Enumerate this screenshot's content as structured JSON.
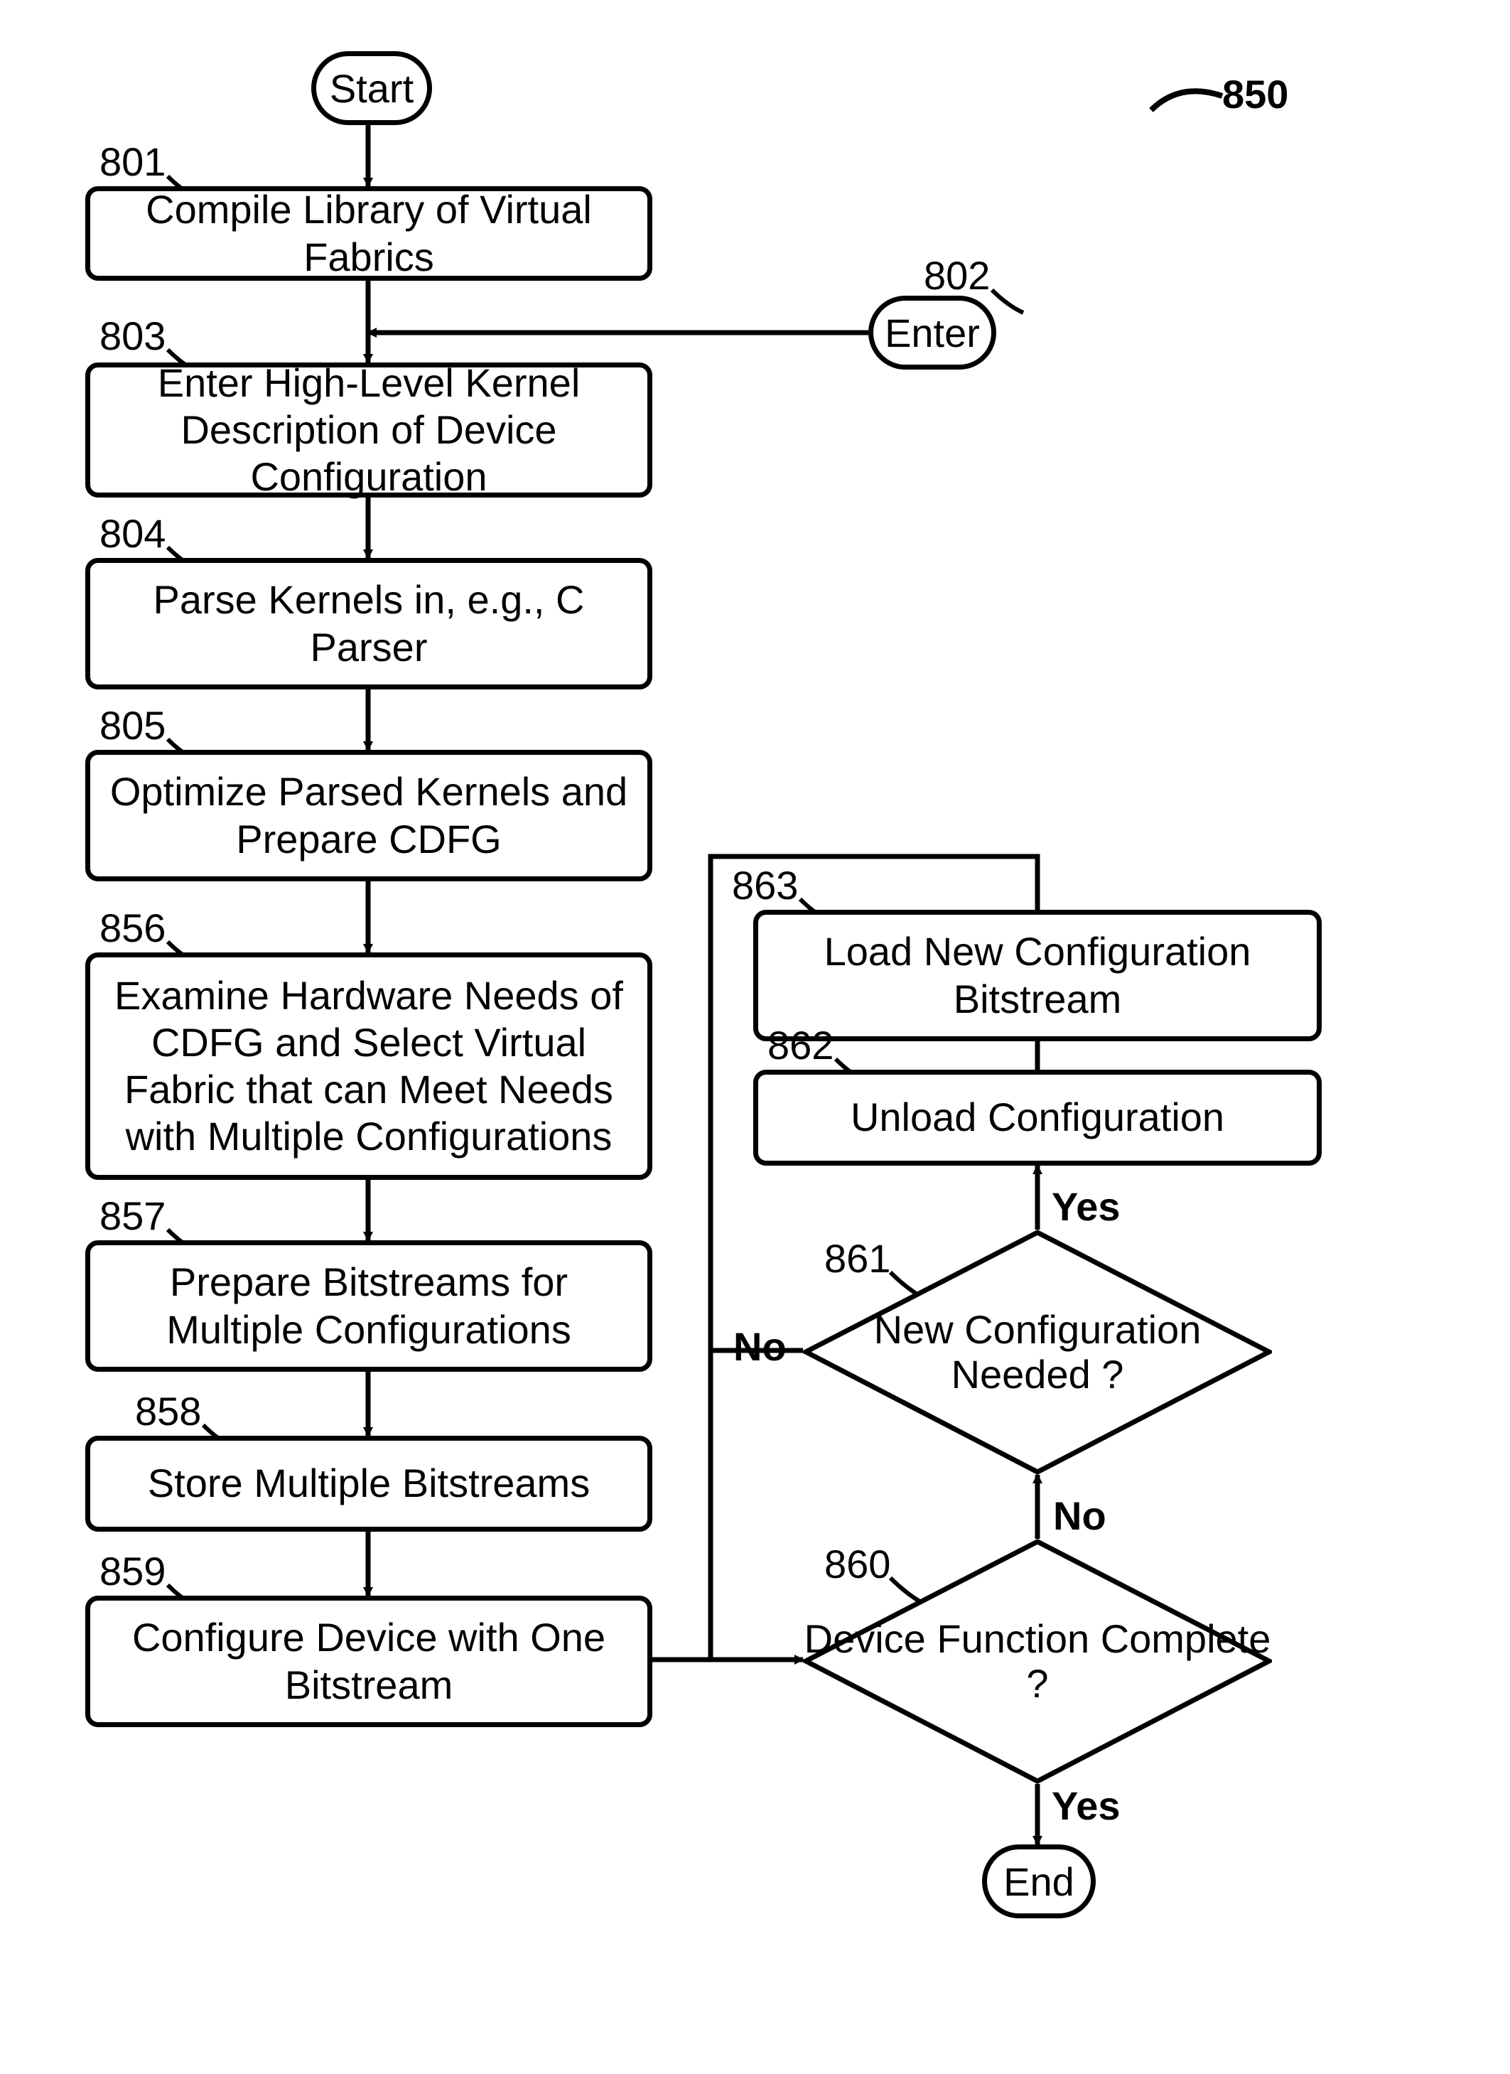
{
  "figure_ref": "850",
  "terminators": {
    "start": "Start",
    "enter": "Enter",
    "end": "End"
  },
  "steps": {
    "s801": {
      "ref": "801",
      "text": "Compile Library of Virtual Fabrics"
    },
    "s803": {
      "ref": "803",
      "text": "Enter High-Level Kernel Description of Device Configuration"
    },
    "s804": {
      "ref": "804",
      "text": "Parse Kernels in, e.g., C Parser"
    },
    "s805": {
      "ref": "805",
      "text": "Optimize Parsed Kernels and Prepare CDFG"
    },
    "s856": {
      "ref": "856",
      "text": "Examine Hardware Needs of CDFG and Select Virtual Fabric that can Meet Needs with Multiple Configurations"
    },
    "s857": {
      "ref": "857",
      "text": "Prepare Bitstreams for Multiple Configurations"
    },
    "s858": {
      "ref": "858",
      "text": "Store Multiple Bitstreams"
    },
    "s859": {
      "ref": "859",
      "text": "Configure Device with One Bitstream"
    },
    "s862": {
      "ref": "862",
      "text": "Unload Configuration"
    },
    "s863": {
      "ref": "863",
      "text": "Load New Configuration Bitstream"
    }
  },
  "decisions": {
    "d860": {
      "ref": "860",
      "text": "Device Function Complete ?"
    },
    "d861": {
      "ref": "861",
      "text": "New Configuration Needed ?"
    }
  },
  "edge_labels": {
    "e860_yes": "Yes",
    "e860_no": "No",
    "e861_yes": "Yes",
    "e861_no": "No"
  },
  "enter_ref": "802"
}
